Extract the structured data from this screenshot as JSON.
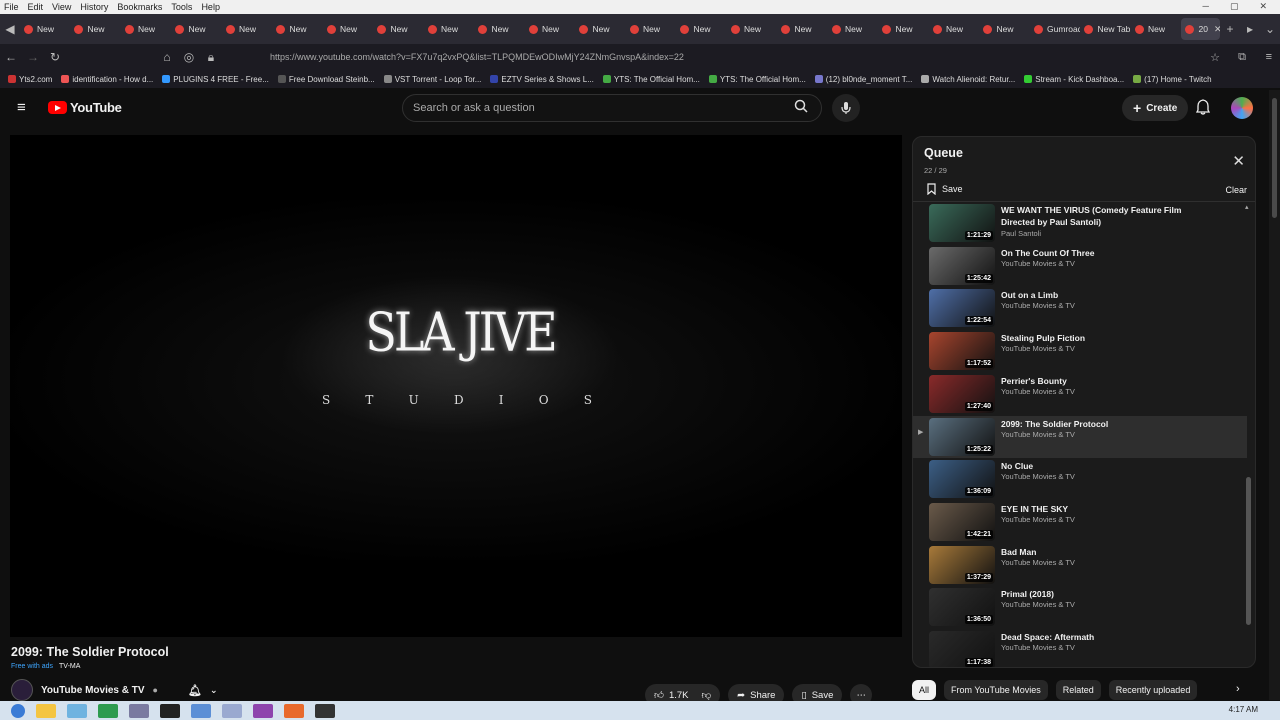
{
  "menubar": {
    "items": [
      "File",
      "Edit",
      "View",
      "History",
      "Bookmarks",
      "Tools",
      "Help"
    ]
  },
  "tabs": [
    {
      "label": "New"
    },
    {
      "label": "New"
    },
    {
      "label": "New"
    },
    {
      "label": "New"
    },
    {
      "label": "New"
    },
    {
      "label": "New"
    },
    {
      "label": "New"
    },
    {
      "label": "New"
    },
    {
      "label": "New"
    },
    {
      "label": "New"
    },
    {
      "label": "New"
    },
    {
      "label": "New"
    },
    {
      "label": "New"
    },
    {
      "label": "New"
    },
    {
      "label": "New"
    },
    {
      "label": "New"
    },
    {
      "label": "New"
    },
    {
      "label": "New"
    },
    {
      "label": "New"
    },
    {
      "label": "New"
    },
    {
      "label": "Gumroad"
    },
    {
      "label": "New Tab"
    },
    {
      "label": "New"
    }
  ],
  "active_tab": {
    "label": "20"
  },
  "address_bar": {
    "url": "https://www.youtube.com/watch?v=FX7u7q2vxPQ&list=TLPQMDEwODIwMjY24ZNmGnvspA&index=22"
  },
  "bookmarks": [
    "Yts2.com",
    "identification - How d...",
    "PLUGINS 4 FREE - Free...",
    "Free Download Steinb...",
    "VST Torrent - Loop Tor...",
    "EZTV Series & Shows L...",
    "YTS: The Official Hom...",
    "YTS: The Official Hom...",
    "(12) bl0nde_moment T...",
    "Watch Alienoid: Retur...",
    "Stream - Kick Dashboa...",
    "(17) Home - Twitch"
  ],
  "youtube": {
    "logo_text": "YouTube",
    "search_placeholder": "Search or ask a question",
    "create_label": "Create"
  },
  "video": {
    "title_card": "SLA JIVE",
    "title_card_sub": [
      "S",
      "T",
      "U",
      "D",
      "I",
      "O",
      "S"
    ],
    "title": "2099: The Soldier Protocol",
    "free_label": "Free with ads",
    "rating": "TV-MA",
    "channel": "YouTube Movies & TV",
    "likes": "1.7K",
    "share_label": "Share",
    "save_label": "Save"
  },
  "queue": {
    "title": "Queue",
    "count": "22 / 29",
    "save_label": "Save",
    "clear_label": "Clear",
    "items": [
      {
        "title": "WE WANT THE VIRUS (Comedy Feature Film Directed by Paul Santoli)",
        "channel": "Paul Santoli",
        "duration": "1:21:29",
        "color": "#3a6b5a"
      },
      {
        "title": "On The Count Of Three",
        "channel": "YouTube Movies & TV",
        "duration": "1:25:42",
        "color": "#6b6b6b"
      },
      {
        "title": "Out on a Limb",
        "channel": "YouTube Movies & TV",
        "duration": "1:22:54",
        "color": "#4f6fa8"
      },
      {
        "title": "Stealing Pulp Fiction",
        "channel": "YouTube Movies & TV",
        "duration": "1:17:52",
        "color": "#a8452e"
      },
      {
        "title": "Perrier's Bounty",
        "channel": "YouTube Movies & TV",
        "duration": "1:27:40",
        "color": "#8a2a2a"
      },
      {
        "title": "2099: The Soldier Protocol",
        "channel": "YouTube Movies & TV",
        "duration": "1:25:22",
        "color": "#5a6f7f",
        "current": true
      },
      {
        "title": "No Clue",
        "channel": "YouTube Movies & TV",
        "duration": "1:36:09",
        "color": "#3c5f86"
      },
      {
        "title": "EYE IN THE SKY",
        "channel": "YouTube Movies & TV",
        "duration": "1:42:21",
        "color": "#6a5a4a"
      },
      {
        "title": "Bad Man",
        "channel": "YouTube Movies & TV",
        "duration": "1:37:29",
        "color": "#a87a3a"
      },
      {
        "title": "Primal (2018)",
        "channel": "YouTube Movies & TV",
        "duration": "1:36:50",
        "color": "#303030"
      },
      {
        "title": "Dead Space: Aftermath",
        "channel": "YouTube Movies & TV",
        "duration": "1:17:38",
        "color": "#2a2a2a"
      }
    ]
  },
  "chips": [
    "All",
    "From YouTube Movies",
    "Related",
    "Recently uploaded"
  ],
  "taskbar": {
    "clock": "4:17 AM"
  },
  "colors": {
    "accent": "#ff0000",
    "background": "#0f0f0f",
    "panel": "#1b1b1b",
    "link": "#3ea6ff"
  }
}
